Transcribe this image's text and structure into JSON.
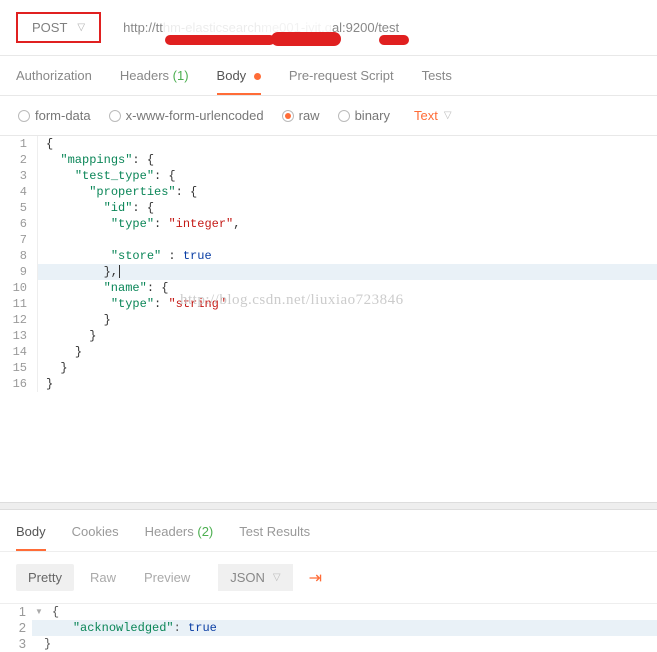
{
  "topbar": {
    "method": "POST",
    "url_prefix": "http://tt",
    "url_mid": "hm-elasticsearch",
    "url_mid2": "me001-jyit.q",
    "url_suffix": "al:9200/test"
  },
  "req_tabs": {
    "auth": "Authorization",
    "headers": "Headers",
    "headers_count": "(1)",
    "body": "Body",
    "prerequest": "Pre-request Script",
    "tests": "Tests"
  },
  "body_opts": {
    "form": "form-data",
    "urlencoded": "x-www-form-urlencoded",
    "raw": "raw",
    "binary": "binary",
    "text_dd": "Text"
  },
  "code": {
    "lines": [
      "1",
      "2",
      "3",
      "4",
      "5",
      "6",
      "7",
      "8",
      "9",
      "10",
      "11",
      "12",
      "13",
      "14",
      "15",
      "16"
    ],
    "l1": "{",
    "l2_k": "\"mappings\"",
    "l2_r": ": {",
    "l3_k": "\"test_type\"",
    "l3_r": ": {",
    "l4_k": "\"properties\"",
    "l4_r": ": {",
    "l5_k": "\"id\"",
    "l5_r": ": {",
    "l6_k": "\"type\"",
    "l6_m": ": ",
    "l6_v": "\"integer\"",
    "l6_r": ",",
    "l8_k": "\"store\"",
    "l8_m": " : ",
    "l8_v": "true",
    "l9": "},",
    "l10_k": "\"name\"",
    "l10_r": ": {",
    "l11_k": "\"type\"",
    "l11_m": ": ",
    "l11_v": "\"string\"",
    "l12": "}",
    "l13": "}",
    "l14": "}",
    "l15": "}",
    "l16": "}"
  },
  "watermark": "http://blog.csdn.net/liuxiao723846",
  "resp_tabs": {
    "body": "Body",
    "cookies": "Cookies",
    "headers": "Headers",
    "headers_count": "(2)",
    "tests": "Test Results"
  },
  "view_bar": {
    "pretty": "Pretty",
    "raw": "Raw",
    "preview": "Preview",
    "json": "JSON"
  },
  "response": {
    "lines": [
      "1",
      "2",
      "3"
    ],
    "l1": "{",
    "l2_k": "\"acknowledged\"",
    "l2_m": ": ",
    "l2_v": "true",
    "l3": "}"
  }
}
